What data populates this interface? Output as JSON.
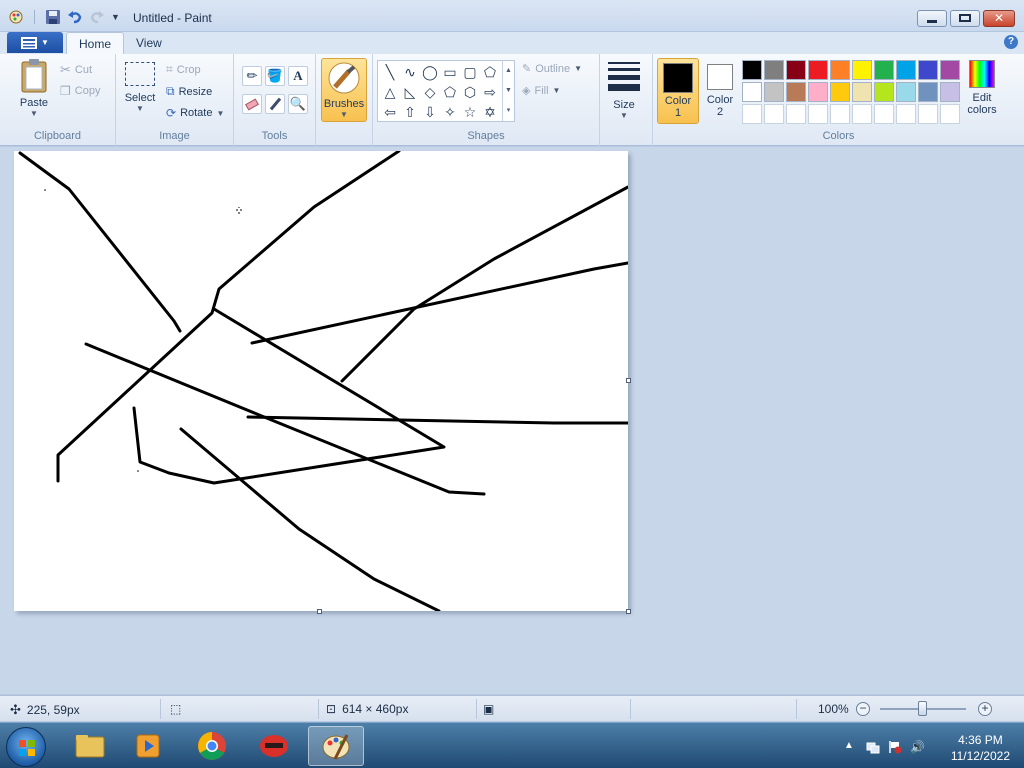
{
  "window": {
    "title": "Untitled - Paint"
  },
  "tabs": [
    {
      "label": "Home",
      "active": true
    },
    {
      "label": "View",
      "active": false
    }
  ],
  "clipboard": {
    "paste": "Paste",
    "cut": "Cut",
    "copy": "Copy",
    "group_label": "Clipboard"
  },
  "image_group": {
    "select": "Select",
    "crop": "Crop",
    "resize": "Resize",
    "rotate": "Rotate",
    "group_label": "Image"
  },
  "tools_group": {
    "text_glyph": "A",
    "group_label": "Tools"
  },
  "brushes": {
    "label": "Brushes"
  },
  "shapes_group": {
    "outline": "Outline",
    "fill": "Fill",
    "group_label": "Shapes"
  },
  "size": {
    "label": "Size"
  },
  "colors_group": {
    "color1_label": "Color",
    "color1_num": "1",
    "color2_label": "Color",
    "color2_num": "2",
    "edit_colors_1": "Edit",
    "edit_colors_2": "colors",
    "group_label": "Colors",
    "color1_value": "#000000",
    "color2_value": "#ffffff",
    "palette_row1": [
      "#000000",
      "#7f7f7f",
      "#880015",
      "#ed1c24",
      "#ff7f27",
      "#fff200",
      "#22b14c",
      "#00a2e8",
      "#3f48cc",
      "#a349a4"
    ],
    "palette_row2": [
      "#ffffff",
      "#c3c3c3",
      "#b97a57",
      "#ffaec9",
      "#ffc90e",
      "#efe4b0",
      "#b5e61d",
      "#99d9ea",
      "#7092be",
      "#c8bfe7"
    ],
    "palette_row3_empty_count": 10
  },
  "status": {
    "cursor_pos": "225, 59px",
    "canvas_size": "614 × 460px",
    "zoom": "100%"
  },
  "taskbar": {
    "time": "4:36 PM",
    "date": "11/12/2022"
  }
}
